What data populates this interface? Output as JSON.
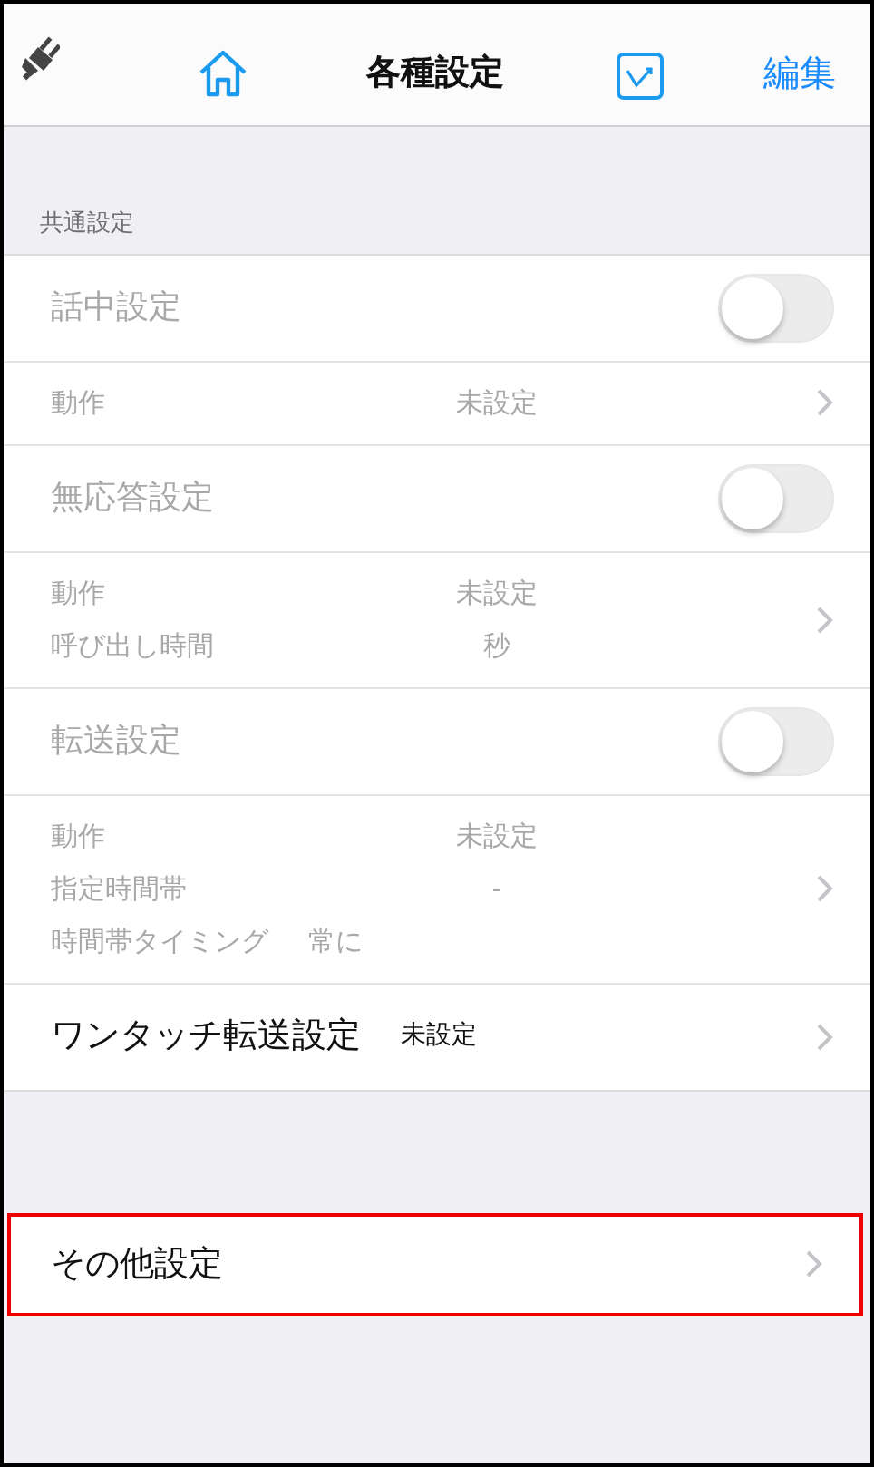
{
  "nav": {
    "title": "各種設定",
    "edit": "編集"
  },
  "section_header": "共通設定",
  "rows": [
    {
      "kind": "toggle",
      "label": "話中設定",
      "disabled": true,
      "on": false
    },
    {
      "kind": "detail",
      "disabled": true,
      "lines": [
        {
          "kind": "column",
          "label": "動作",
          "value": "未設定"
        }
      ]
    },
    {
      "kind": "toggle",
      "label": "無応答設定",
      "disabled": true,
      "on": false
    },
    {
      "kind": "detail",
      "disabled": true,
      "lines": [
        {
          "kind": "column",
          "label": "動作",
          "value": "未設定"
        },
        {
          "kind": "column",
          "label": "呼び出し時間",
          "value": "秒"
        }
      ]
    },
    {
      "kind": "toggle",
      "label": "転送設定",
      "disabled": true,
      "on": false
    },
    {
      "kind": "detail",
      "disabled": true,
      "lines": [
        {
          "kind": "column",
          "label": "動作",
          "value": "未設定"
        },
        {
          "kind": "column",
          "label": "指定時間帯",
          "value": "-"
        },
        {
          "kind": "inline",
          "label": "時間帯タイミング",
          "value": "常に"
        }
      ]
    },
    {
      "kind": "link",
      "label": "ワンタッチ転送設定",
      "value": "未設定",
      "disabled": false
    }
  ],
  "other": {
    "label": "その他設定",
    "highlighted": true
  }
}
